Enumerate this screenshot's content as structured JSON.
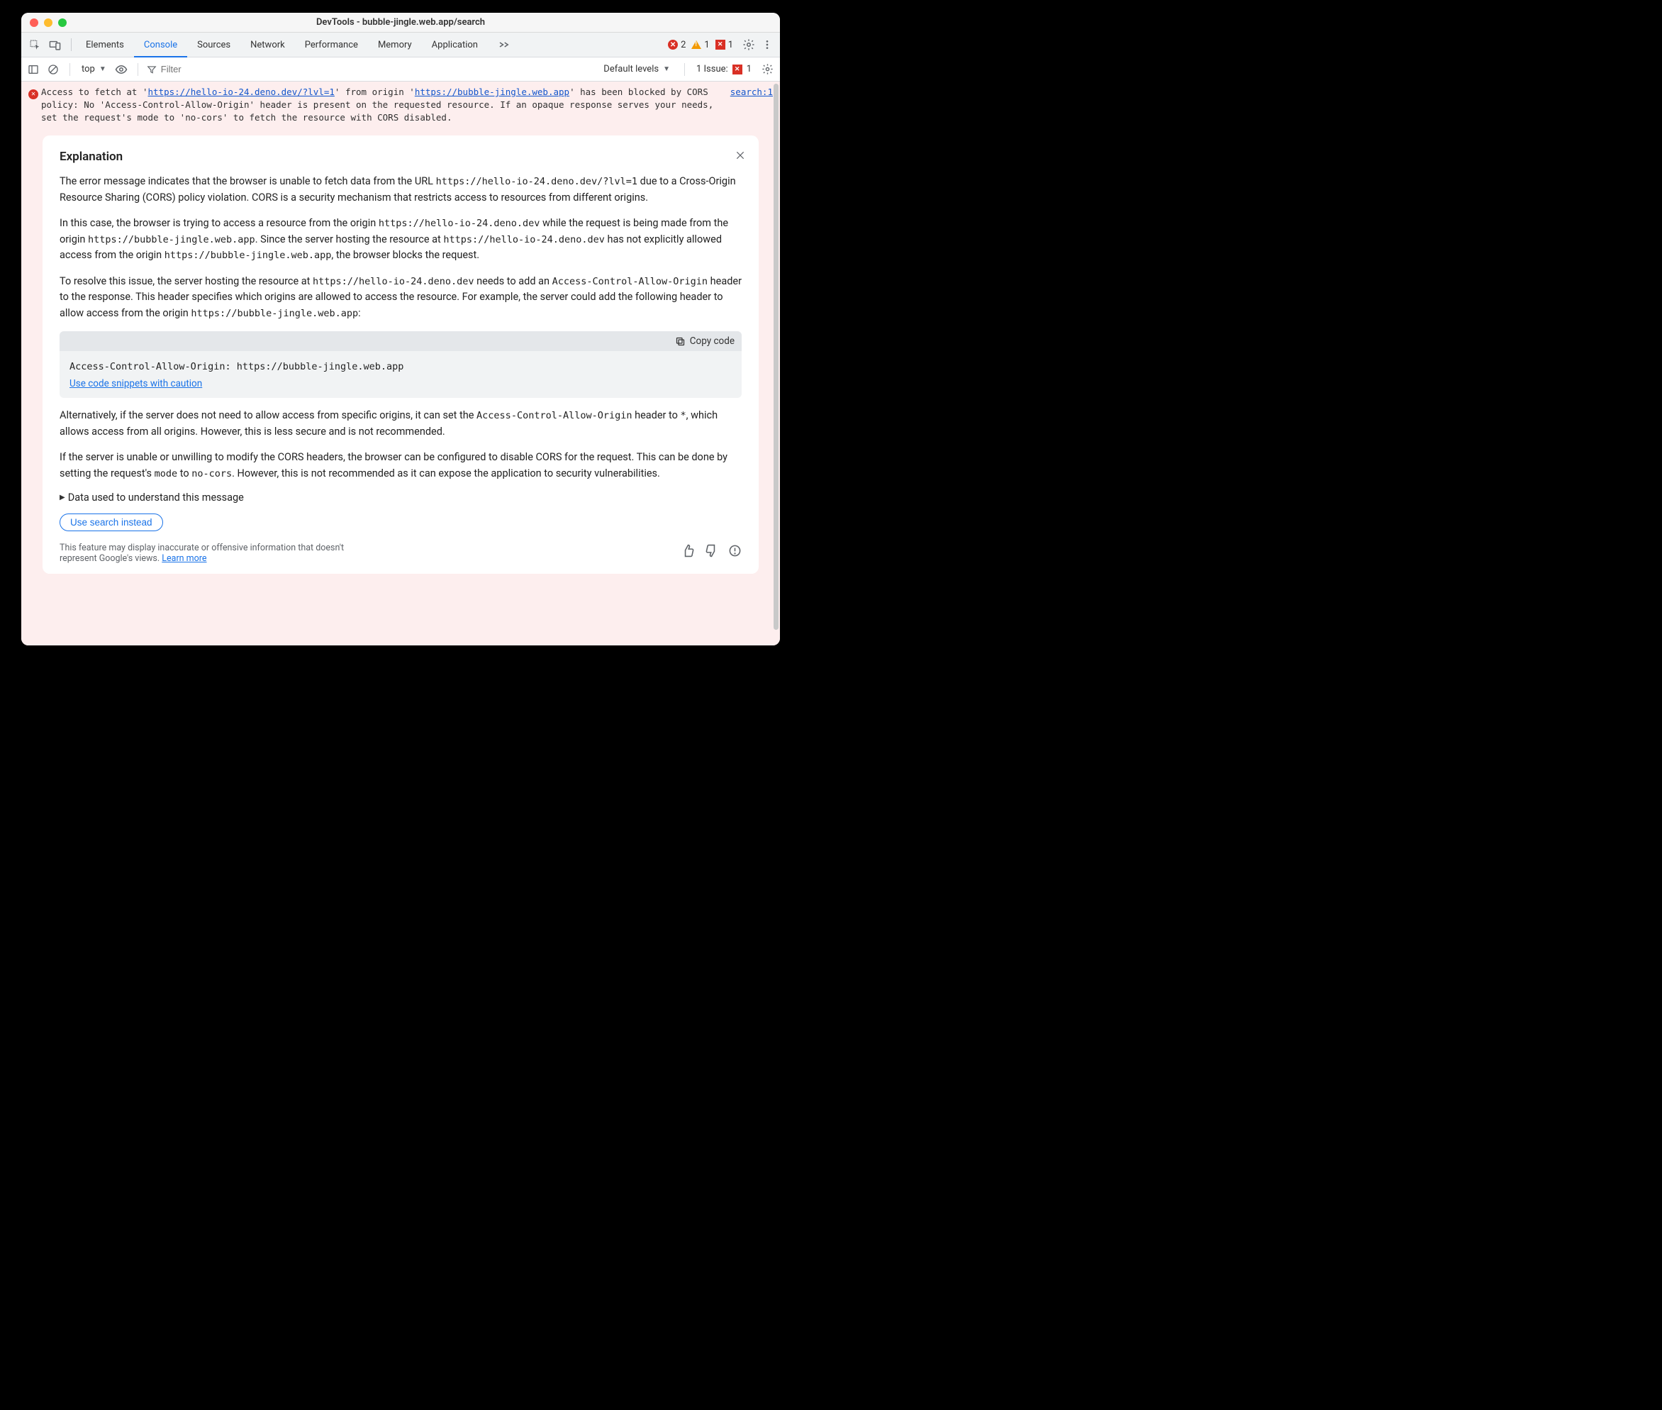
{
  "window": {
    "title": "DevTools - bubble-jingle.web.app/search"
  },
  "mainTabs": {
    "items": [
      "Elements",
      "Console",
      "Sources",
      "Network",
      "Performance",
      "Memory",
      "Application"
    ],
    "activeIndex": 1
  },
  "badges": {
    "errors": "2",
    "warnings": "1",
    "blocked": "1"
  },
  "subToolbar": {
    "context": "top",
    "filterPlaceholder": "Filter",
    "levels": "Default levels",
    "issuesLabel": "1 Issue:",
    "issuesCount": "1"
  },
  "error": {
    "prefix": "Access to fetch at '",
    "url1": "https://hello-io-24.deno.dev/?lvl=1",
    "mid1": "' from origin '",
    "url2": "https://bubble-jingle.web.app",
    "tail": "' has been blocked by CORS policy: No 'Access-Control-Allow-Origin' header is present on the requested resource. If an opaque response serves your needs, set the request's mode to 'no-cors' to fetch the resource with CORS disabled.",
    "sourceLink": "search:1"
  },
  "panel": {
    "title": "Explanation",
    "p1a": "The error message indicates that the browser is unable to fetch data from the URL ",
    "p1code": "https://hello-io-24.deno.dev/?lvl=1",
    "p1b": " due to a Cross-Origin Resource Sharing (CORS) policy violation. CORS is a security mechanism that restricts access to resources from different origins.",
    "p2a": "In this case, the browser is trying to access a resource from the origin ",
    "p2code1": "https://hello-io-24.deno.dev",
    "p2b": " while the request is being made from the origin ",
    "p2code2": "https://bubble-jingle.web.app",
    "p2c": ". Since the server hosting the resource at ",
    "p2code3": "https://hello-io-24.deno.dev",
    "p2d": " has not explicitly allowed access from the origin ",
    "p2code4": "https://bubble-jingle.web.app",
    "p2e": ", the browser blocks the request.",
    "p3a": "To resolve this issue, the server hosting the resource at ",
    "p3code1": "https://hello-io-24.deno.dev",
    "p3b": " needs to add an ",
    "p3code2": "Access-Control-Allow-Origin",
    "p3c": " header to the response. This header specifies which origins are allowed to access the resource. For example, the server could add the following header to allow access from the origin ",
    "p3code3": "https://bubble-jingle.web.app",
    "p3d": ":",
    "copyLabel": "Copy code",
    "codeSnippet": "Access-Control-Allow-Origin: https://bubble-jingle.web.app",
    "cautionLink": "Use code snippets with caution",
    "p4a": "Alternatively, if the server does not need to allow access from specific origins, it can set the ",
    "p4code1": "Access-Control-Allow-Origin",
    "p4b": " header to ",
    "p4code2": "*",
    "p4c": ", which allows access from all origins. However, this is less secure and is not recommended.",
    "p5a": "If the server is unable or unwilling to modify the CORS headers, the browser can be configured to disable CORS for the request. This can be done by setting the request's ",
    "p5code1": "mode",
    "p5b": " to ",
    "p5code2": "no-cors",
    "p5c": ". However, this is not recommended as it can expose the application to security vulnerabilities.",
    "disclosure": "Data used to understand this message",
    "searchBtn": "Use search instead",
    "disclaimer": "This feature may display inaccurate or offensive information that doesn't represent Google's views. ",
    "learnMore": "Learn more"
  }
}
